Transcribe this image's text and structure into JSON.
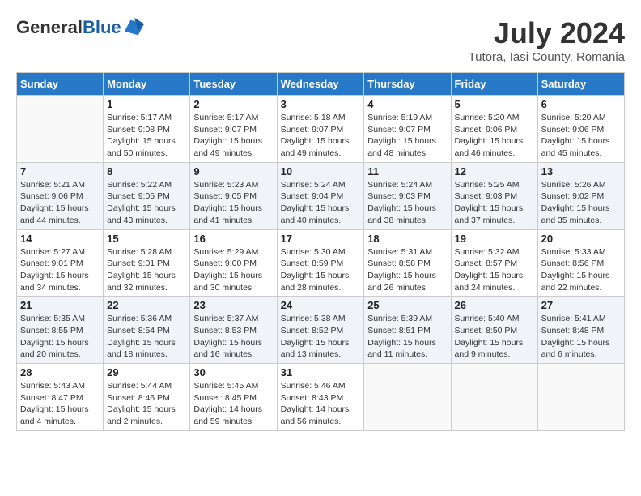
{
  "header": {
    "logo_general": "General",
    "logo_blue": "Blue",
    "month_year": "July 2024",
    "location": "Tutora, Iasi County, Romania"
  },
  "days_of_week": [
    "Sunday",
    "Monday",
    "Tuesday",
    "Wednesday",
    "Thursday",
    "Friday",
    "Saturday"
  ],
  "weeks": [
    [
      {
        "day": "",
        "info": ""
      },
      {
        "day": "1",
        "info": "Sunrise: 5:17 AM\nSunset: 9:08 PM\nDaylight: 15 hours\nand 50 minutes."
      },
      {
        "day": "2",
        "info": "Sunrise: 5:17 AM\nSunset: 9:07 PM\nDaylight: 15 hours\nand 49 minutes."
      },
      {
        "day": "3",
        "info": "Sunrise: 5:18 AM\nSunset: 9:07 PM\nDaylight: 15 hours\nand 49 minutes."
      },
      {
        "day": "4",
        "info": "Sunrise: 5:19 AM\nSunset: 9:07 PM\nDaylight: 15 hours\nand 48 minutes."
      },
      {
        "day": "5",
        "info": "Sunrise: 5:20 AM\nSunset: 9:06 PM\nDaylight: 15 hours\nand 46 minutes."
      },
      {
        "day": "6",
        "info": "Sunrise: 5:20 AM\nSunset: 9:06 PM\nDaylight: 15 hours\nand 45 minutes."
      }
    ],
    [
      {
        "day": "7",
        "info": "Sunrise: 5:21 AM\nSunset: 9:06 PM\nDaylight: 15 hours\nand 44 minutes."
      },
      {
        "day": "8",
        "info": "Sunrise: 5:22 AM\nSunset: 9:05 PM\nDaylight: 15 hours\nand 43 minutes."
      },
      {
        "day": "9",
        "info": "Sunrise: 5:23 AM\nSunset: 9:05 PM\nDaylight: 15 hours\nand 41 minutes."
      },
      {
        "day": "10",
        "info": "Sunrise: 5:24 AM\nSunset: 9:04 PM\nDaylight: 15 hours\nand 40 minutes."
      },
      {
        "day": "11",
        "info": "Sunrise: 5:24 AM\nSunset: 9:03 PM\nDaylight: 15 hours\nand 38 minutes."
      },
      {
        "day": "12",
        "info": "Sunrise: 5:25 AM\nSunset: 9:03 PM\nDaylight: 15 hours\nand 37 minutes."
      },
      {
        "day": "13",
        "info": "Sunrise: 5:26 AM\nSunset: 9:02 PM\nDaylight: 15 hours\nand 35 minutes."
      }
    ],
    [
      {
        "day": "14",
        "info": "Sunrise: 5:27 AM\nSunset: 9:01 PM\nDaylight: 15 hours\nand 34 minutes."
      },
      {
        "day": "15",
        "info": "Sunrise: 5:28 AM\nSunset: 9:01 PM\nDaylight: 15 hours\nand 32 minutes."
      },
      {
        "day": "16",
        "info": "Sunrise: 5:29 AM\nSunset: 9:00 PM\nDaylight: 15 hours\nand 30 minutes."
      },
      {
        "day": "17",
        "info": "Sunrise: 5:30 AM\nSunset: 8:59 PM\nDaylight: 15 hours\nand 28 minutes."
      },
      {
        "day": "18",
        "info": "Sunrise: 5:31 AM\nSunset: 8:58 PM\nDaylight: 15 hours\nand 26 minutes."
      },
      {
        "day": "19",
        "info": "Sunrise: 5:32 AM\nSunset: 8:57 PM\nDaylight: 15 hours\nand 24 minutes."
      },
      {
        "day": "20",
        "info": "Sunrise: 5:33 AM\nSunset: 8:56 PM\nDaylight: 15 hours\nand 22 minutes."
      }
    ],
    [
      {
        "day": "21",
        "info": "Sunrise: 5:35 AM\nSunset: 8:55 PM\nDaylight: 15 hours\nand 20 minutes."
      },
      {
        "day": "22",
        "info": "Sunrise: 5:36 AM\nSunset: 8:54 PM\nDaylight: 15 hours\nand 18 minutes."
      },
      {
        "day": "23",
        "info": "Sunrise: 5:37 AM\nSunset: 8:53 PM\nDaylight: 15 hours\nand 16 minutes."
      },
      {
        "day": "24",
        "info": "Sunrise: 5:38 AM\nSunset: 8:52 PM\nDaylight: 15 hours\nand 13 minutes."
      },
      {
        "day": "25",
        "info": "Sunrise: 5:39 AM\nSunset: 8:51 PM\nDaylight: 15 hours\nand 11 minutes."
      },
      {
        "day": "26",
        "info": "Sunrise: 5:40 AM\nSunset: 8:50 PM\nDaylight: 15 hours\nand 9 minutes."
      },
      {
        "day": "27",
        "info": "Sunrise: 5:41 AM\nSunset: 8:48 PM\nDaylight: 15 hours\nand 6 minutes."
      }
    ],
    [
      {
        "day": "28",
        "info": "Sunrise: 5:43 AM\nSunset: 8:47 PM\nDaylight: 15 hours\nand 4 minutes."
      },
      {
        "day": "29",
        "info": "Sunrise: 5:44 AM\nSunset: 8:46 PM\nDaylight: 15 hours\nand 2 minutes."
      },
      {
        "day": "30",
        "info": "Sunrise: 5:45 AM\nSunset: 8:45 PM\nDaylight: 14 hours\nand 59 minutes."
      },
      {
        "day": "31",
        "info": "Sunrise: 5:46 AM\nSunset: 8:43 PM\nDaylight: 14 hours\nand 56 minutes."
      },
      {
        "day": "",
        "info": ""
      },
      {
        "day": "",
        "info": ""
      },
      {
        "day": "",
        "info": ""
      }
    ]
  ]
}
